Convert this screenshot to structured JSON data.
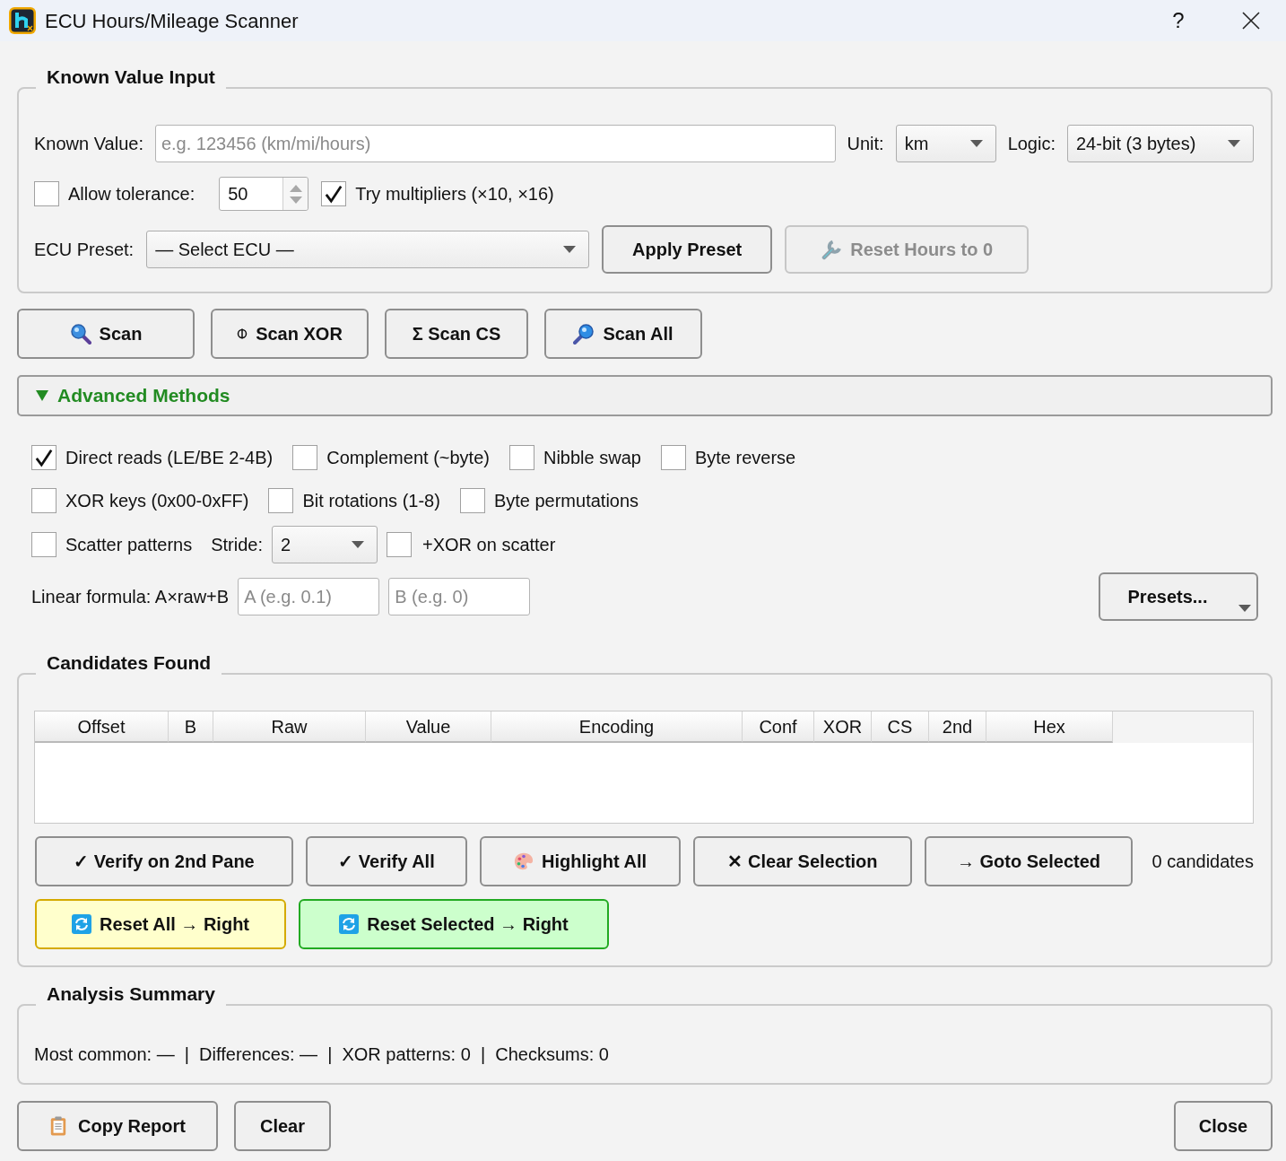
{
  "window": {
    "title": "ECU Hours/Mileage Scanner",
    "help": "?"
  },
  "known_value_input": {
    "title": "Known Value Input",
    "known_value": {
      "label": "Known Value:",
      "placeholder": "e.g. 123456 (km/mi/hours)"
    },
    "unit": {
      "label": "Unit:",
      "value": "km"
    },
    "logic": {
      "label": "Logic:",
      "value": "24-bit (3 bytes)"
    },
    "tolerance": {
      "label": "Allow tolerance:",
      "checked": false,
      "value": "50"
    },
    "multipliers": {
      "label": "Try multipliers (×10, ×16)",
      "checked": true
    },
    "ecu_preset": {
      "label": "ECU Preset:",
      "value": "— Select ECU —"
    },
    "buttons": [
      {
        "label": "Apply Preset",
        "kind": "plain",
        "disabled": false
      },
      {
        "label": "Reset Hours to 0",
        "kind": "wrench",
        "disabled": true
      }
    ]
  },
  "scan_buttons": [
    {
      "label": "Scan",
      "kind": "lens"
    },
    {
      "label": "Scan XOR",
      "kind": "xor"
    },
    {
      "label": "Σ Scan CS",
      "kind": "plain"
    },
    {
      "label": "Scan All",
      "kind": "lens2"
    }
  ],
  "advanced_methods": {
    "title": "Advanced Methods",
    "expanded": true,
    "checkbox_rows": [
      [
        {
          "label": "Direct reads (LE/BE 2-4B)",
          "checked": true
        },
        {
          "label": "Complement (~byte)",
          "checked": false
        },
        {
          "label": "Nibble swap",
          "checked": false
        },
        {
          "label": "Byte reverse",
          "checked": false
        }
      ],
      [
        {
          "label": "XOR keys (0x00-0xFF)",
          "checked": false
        },
        {
          "label": "Bit rotations (1-8)",
          "checked": false
        },
        {
          "label": "Byte permutations",
          "checked": false
        }
      ]
    ],
    "scatter": {
      "label": "Scatter patterns",
      "checked": false
    },
    "stride": {
      "label": "Stride:",
      "value": "2"
    },
    "xor_on_scatter": {
      "label": "+XOR on scatter",
      "checked": false
    },
    "linear_formula": {
      "label": "Linear formula: A×raw+B",
      "a_placeholder": "A (e.g. 0.1)",
      "b_placeholder": "B (e.g. 0)"
    },
    "presets_button": {
      "label": "Presets..."
    }
  },
  "candidates_found": {
    "title": "Candidates Found",
    "table": {
      "columns": [
        "Offset",
        "B",
        "Raw",
        "Value",
        "Encoding",
        "Conf",
        "XOR",
        "CS",
        "2nd",
        "Hex"
      ]
    },
    "action_buttons": [
      {
        "label": "✓ Verify on 2nd Pane",
        "kind": "plain"
      },
      {
        "label": "✓ Verify All",
        "kind": "plain"
      },
      {
        "label": "Highlight All",
        "kind": "palette"
      },
      {
        "label": "✕ Clear Selection",
        "kind": "plain"
      },
      {
        "label": "→ Goto Selected",
        "kind": "plain"
      }
    ],
    "count": "0 candidates",
    "reset_buttons": [
      {
        "label": "Reset All → Right",
        "kind": "caution"
      },
      {
        "label": "Reset Selected → Right",
        "kind": "confirm"
      }
    ]
  },
  "analysis_summary": {
    "title": "Analysis Summary",
    "text": "Most common: —  |  Differences: —  |  XOR patterns: 0  |  Checksums: 0"
  },
  "footer": {
    "buttons": [
      {
        "label": "Copy Report",
        "kind": "clipboard"
      },
      {
        "label": "Clear",
        "kind": "plain"
      }
    ],
    "close_button": "Close"
  }
}
